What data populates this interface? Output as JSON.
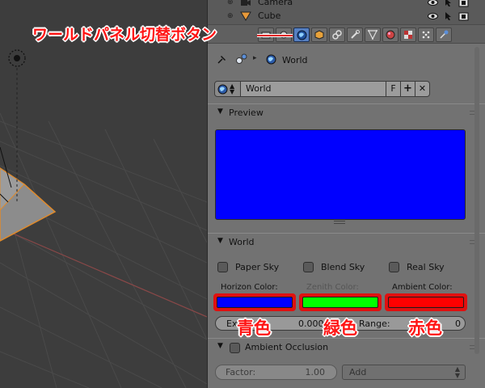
{
  "outliner": {
    "items": [
      {
        "label": "Camera",
        "icon": "camera-object-icon"
      },
      {
        "label": "Cube",
        "icon": "mesh-object-icon"
      }
    ]
  },
  "properties": {
    "context_tabs": [
      "render",
      "render-layers",
      "scene",
      "world",
      "object",
      "constraints",
      "modifiers",
      "data",
      "material",
      "texture",
      "particles",
      "physics"
    ],
    "active_tab": "world",
    "breadcrumb": {
      "label": "World"
    },
    "world_selector": {
      "name": "World",
      "fake_user": "F",
      "add": "+",
      "remove": "✕"
    },
    "preview_panel": {
      "title": "Preview",
      "preview_color": "#0000ff"
    },
    "world_panel": {
      "title": "World",
      "checkboxes": [
        "Paper Sky",
        "Blend Sky",
        "Real Sky"
      ],
      "horizon_label": "Horizon Color:",
      "zenith_label": "Zenith Color:",
      "ambient_label": "Ambient Color:",
      "horizon_color": "#0000ff",
      "zenith_color": "#00ff00",
      "ambient_color": "#ff0000",
      "exposure_fragment": "Ex",
      "exposure_value_fragment": "0.000",
      "range_fragment": "Range:",
      "range_value_fragment": "0"
    },
    "ao_panel": {
      "title": "Ambient Occlusion",
      "factor_label": "Factor:",
      "factor_value": "1.00",
      "blend_mode": "Add"
    }
  },
  "annotations": {
    "world_button_note": "ワールドパネル切替ボタン",
    "blue_note": "青色",
    "green_note": "緑色",
    "red_note": "赤色"
  }
}
